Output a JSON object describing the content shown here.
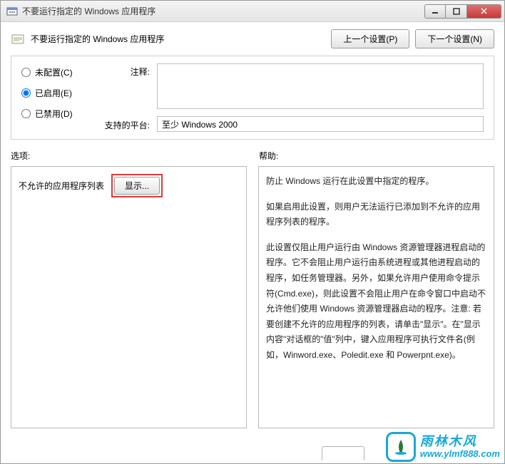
{
  "titlebar": {
    "title": "不要运行指定的 Windows 应用程序"
  },
  "header": {
    "title": "不要运行指定的 Windows 应用程序",
    "prev_btn": "上一个设置(P)",
    "next_btn": "下一个设置(N)"
  },
  "radios": {
    "not_configured": "未配置(C)",
    "enabled": "已启用(E)",
    "disabled": "已禁用(D)",
    "selected": "enabled"
  },
  "fields": {
    "comment_label": "注释:",
    "comment_value": "",
    "platform_label": "支持的平台:",
    "platform_value": "至少 Windows 2000"
  },
  "sections": {
    "options_label": "选项:",
    "help_label": "帮助:"
  },
  "options": {
    "list_label": "不允许的应用程序列表",
    "show_btn": "显示..."
  },
  "help": {
    "p1": "防止 Windows 运行在此设置中指定的程序。",
    "p2": "如果启用此设置，则用户无法运行已添加到不允许的应用程序列表的程序。",
    "p3": "此设置仅阻止用户运行由 Windows 资源管理器进程启动的程序。它不会阻止用户运行由系统进程或其他进程启动的程序，如任务管理器。另外，如果允许用户使用命令提示符(Cmd.exe)，则此设置不会阻止用户在命令窗口中启动不允许他们使用 Windows 资源管理器启动的程序。注意: 若要创建不允许的应用程序的列表，请单击\"显示\"。在\"显示内容\"对话框的\"值\"列中，键入应用程序可执行文件名(例如，Winword.exe、Poledit.exe 和 Powerpnt.exe)。"
  },
  "watermark": {
    "cn": "雨林木风",
    "url": "www.ylmf888.com"
  }
}
